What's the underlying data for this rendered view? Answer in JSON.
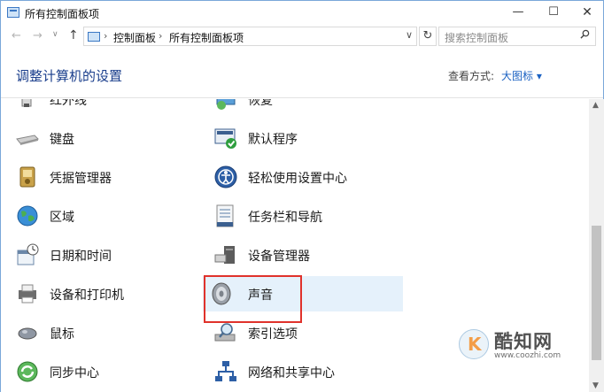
{
  "window": {
    "title": "所有控制面板项",
    "min_glyph": "—",
    "max_glyph": "☐",
    "close_glyph": "✕"
  },
  "navbar": {
    "back_glyph": "←",
    "forward_glyph": "→",
    "recent_glyph": "∨",
    "up_glyph": "↑",
    "sep_glyph": "›",
    "breadcrumbs": [
      "控制面板",
      "所有控制面板项"
    ],
    "dropdown_glyph": "∨",
    "refresh_glyph": "↻",
    "search_placeholder": "搜索控制面板"
  },
  "header": {
    "title": "调整计算机的设置",
    "view_label": "查看方式:",
    "view_value": "大图标 ▾"
  },
  "items_left": [
    {
      "label": "红外线",
      "icon": "infrared-icon"
    },
    {
      "label": "键盘",
      "icon": "keyboard-icon"
    },
    {
      "label": "凭据管理器",
      "icon": "credential-manager-icon"
    },
    {
      "label": "区域",
      "icon": "region-globe-icon"
    },
    {
      "label": "日期和时间",
      "icon": "date-time-icon"
    },
    {
      "label": "设备和打印机",
      "icon": "printer-icon"
    },
    {
      "label": "鼠标",
      "icon": "mouse-icon"
    },
    {
      "label": "同步中心",
      "icon": "sync-center-icon"
    }
  ],
  "items_right": [
    {
      "label": "恢复",
      "icon": "recovery-icon"
    },
    {
      "label": "默认程序",
      "icon": "default-programs-icon"
    },
    {
      "label": "轻松使用设置中心",
      "icon": "ease-of-access-icon"
    },
    {
      "label": "任务栏和导航",
      "icon": "taskbar-icon"
    },
    {
      "label": "设备管理器",
      "icon": "device-manager-icon"
    },
    {
      "label": "声音",
      "icon": "sound-speaker-icon"
    },
    {
      "label": "索引选项",
      "icon": "indexing-options-icon"
    },
    {
      "label": "网络和共享中心",
      "icon": "network-sharing-icon"
    }
  ],
  "scrollbar": {
    "up_glyph": "▲",
    "down_glyph": "▼"
  },
  "watermark": {
    "name": "酷知网",
    "url": "www.coozhi.com"
  },
  "colors": {
    "accent": "#1a61c2",
    "highlight": "#e5f1fb",
    "callout": "#e0322b"
  }
}
